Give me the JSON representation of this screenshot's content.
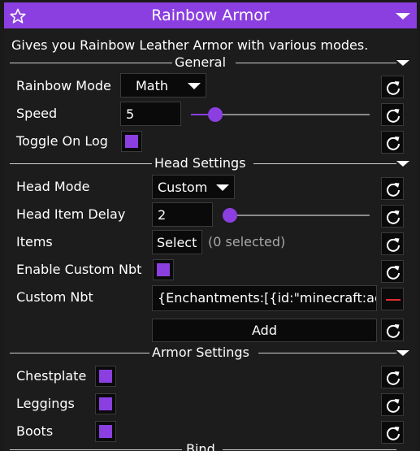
{
  "module": {
    "title": "Rainbow Armor",
    "description": "Gives you Rainbow Leather Armor with various modes."
  },
  "sections": {
    "general": "General",
    "head": "Head Settings",
    "armor": "Armor Settings",
    "bind": "Bind"
  },
  "settings": {
    "rainbow_mode": {
      "label": "Rainbow Mode",
      "value": "Math"
    },
    "speed": {
      "label": "Speed",
      "value": "5",
      "slider_fraction": 0.14
    },
    "toggle_on_log": {
      "label": "Toggle On Log",
      "checked": true
    },
    "head_mode": {
      "label": "Head Mode",
      "value": "Custom"
    },
    "head_item_delay": {
      "label": "Head Item Delay",
      "value": "2",
      "slider_fraction": 0.0
    },
    "items": {
      "label": "Items",
      "button": "Select",
      "status": "(0 selected)"
    },
    "enable_custom_nbt": {
      "label": "Enable Custom Nbt",
      "checked": true
    },
    "custom_nbt": {
      "label": "Custom Nbt",
      "value": "{Enchantments:[{id:\"minecraft:ac"
    },
    "add_button": "Add",
    "chestplate": {
      "label": "Chestplate",
      "checked": true
    },
    "leggings": {
      "label": "Leggings",
      "checked": true
    },
    "boots": {
      "label": "Boots",
      "checked": true
    }
  },
  "colors": {
    "accent": "#8b3fe0",
    "remove": "#e03030",
    "background": "#1c1c1c",
    "field": "#0a0a0a"
  },
  "icons": {
    "favorite": "star-icon",
    "reset": "reset-icon",
    "collapse": "collapse-triangle-icon",
    "remove": "minus-icon"
  }
}
